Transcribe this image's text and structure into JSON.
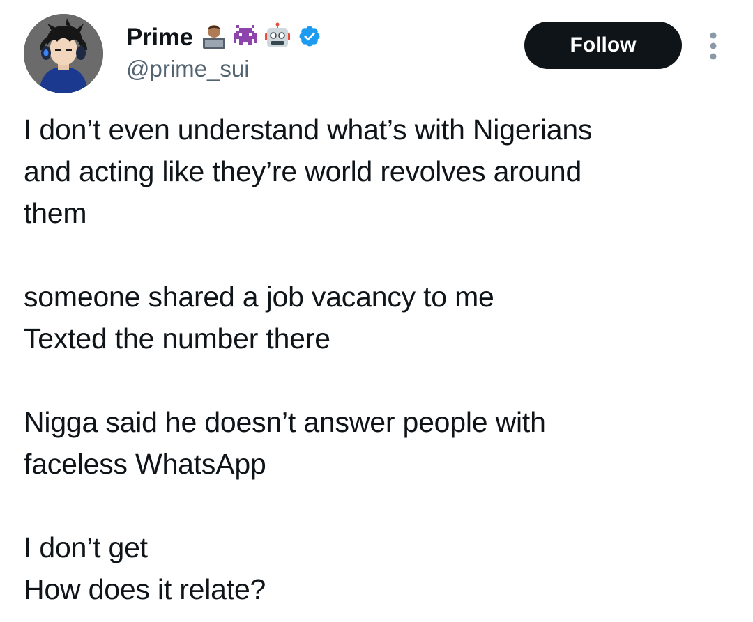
{
  "author": {
    "display_name": "Prime",
    "handle": "@prime_sui",
    "name_emojis": [
      "technologist-emoji",
      "space-invader-emoji",
      "robot-emoji"
    ],
    "verified": true,
    "verified_color": "#1d9bf0"
  },
  "actions": {
    "follow_label": "Follow",
    "more_icon": "ellipsis-vertical-icon"
  },
  "tweet": {
    "paragraphs": [
      [
        "I don’t even understand what’s with Nigerians",
        "and acting like they’re world revolves around",
        "them"
      ],
      [
        "someone shared a job vacancy to me",
        "Texted the number there"
      ],
      [
        "Nigga said he doesn’t answer people with",
        "faceless WhatsApp"
      ],
      [
        "I don’t get",
        "How does it relate?"
      ]
    ]
  },
  "colors": {
    "text_primary": "#0f1419",
    "text_secondary": "#536471",
    "follow_bg": "#0f1419",
    "follow_text": "#ffffff"
  }
}
